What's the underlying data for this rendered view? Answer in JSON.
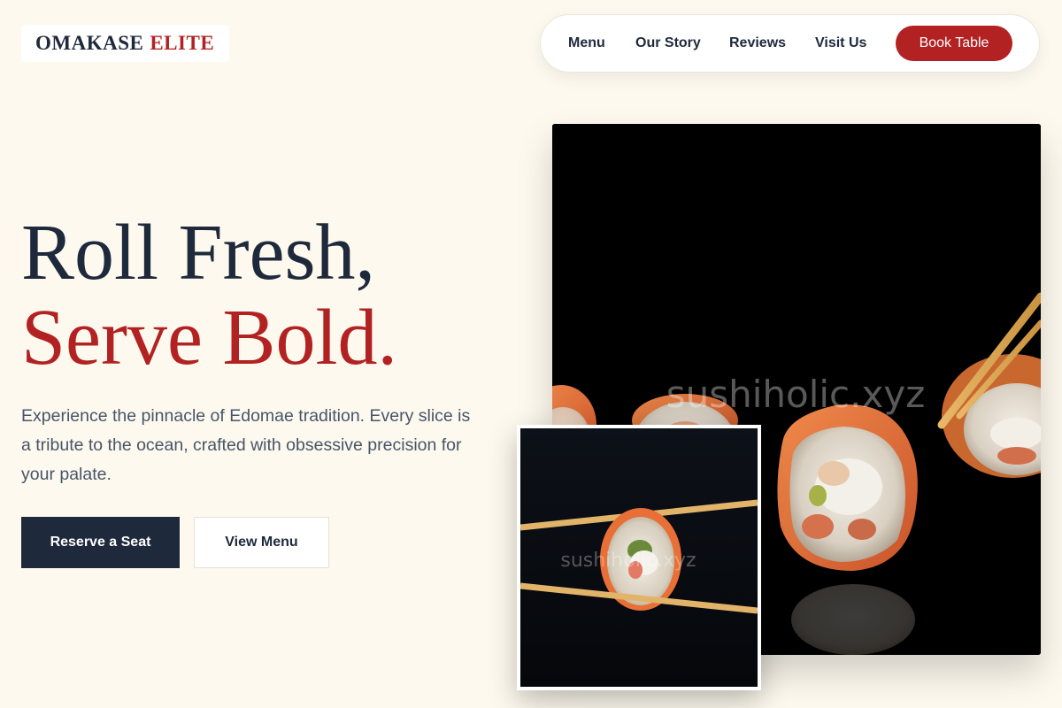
{
  "brand": {
    "name": "OMAKASE",
    "accent": "ELITE"
  },
  "nav": {
    "links": [
      "Menu",
      "Our Story",
      "Reviews",
      "Visit Us"
    ],
    "cta": "Book Table"
  },
  "hero": {
    "headline_line1": "Roll Fresh,",
    "headline_line2": "Serve Bold.",
    "lead": "Experience the pinnacle of Edomae tradition. Every slice is a tribute to the ocean, crafted with obsessive precision for your palate.",
    "primary_button": "Reserve a Seat",
    "secondary_button": "View Menu"
  },
  "images": {
    "main_watermark": "sushiholic.xyz",
    "small_watermark": "sushiholic.xyz"
  },
  "colors": {
    "background": "#fdf9ee",
    "navy": "#1e293b",
    "accent_red": "#b32222",
    "body_text": "#475569"
  }
}
